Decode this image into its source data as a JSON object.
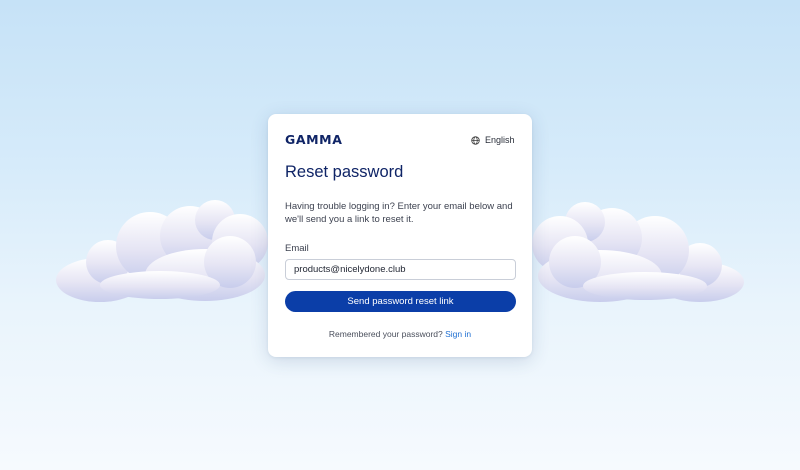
{
  "brand": {
    "logo_text": "GAMMA"
  },
  "language": {
    "label": "English",
    "icon": "globe-icon"
  },
  "form": {
    "title": "Reset password",
    "description": "Having trouble logging in? Enter your email below and we'll send you a link to reset it.",
    "email_label": "Email",
    "email_value": "products@nicelydone.club",
    "submit_label": "Send password reset link"
  },
  "footer": {
    "prompt": "Remembered your password?",
    "link_label": "Sign in"
  },
  "colors": {
    "primary": "#0b3ea8",
    "heading": "#0f2466",
    "link": "#1f6fd1",
    "background_top": "#c6e2f7",
    "background_bottom": "#f6fafe"
  }
}
